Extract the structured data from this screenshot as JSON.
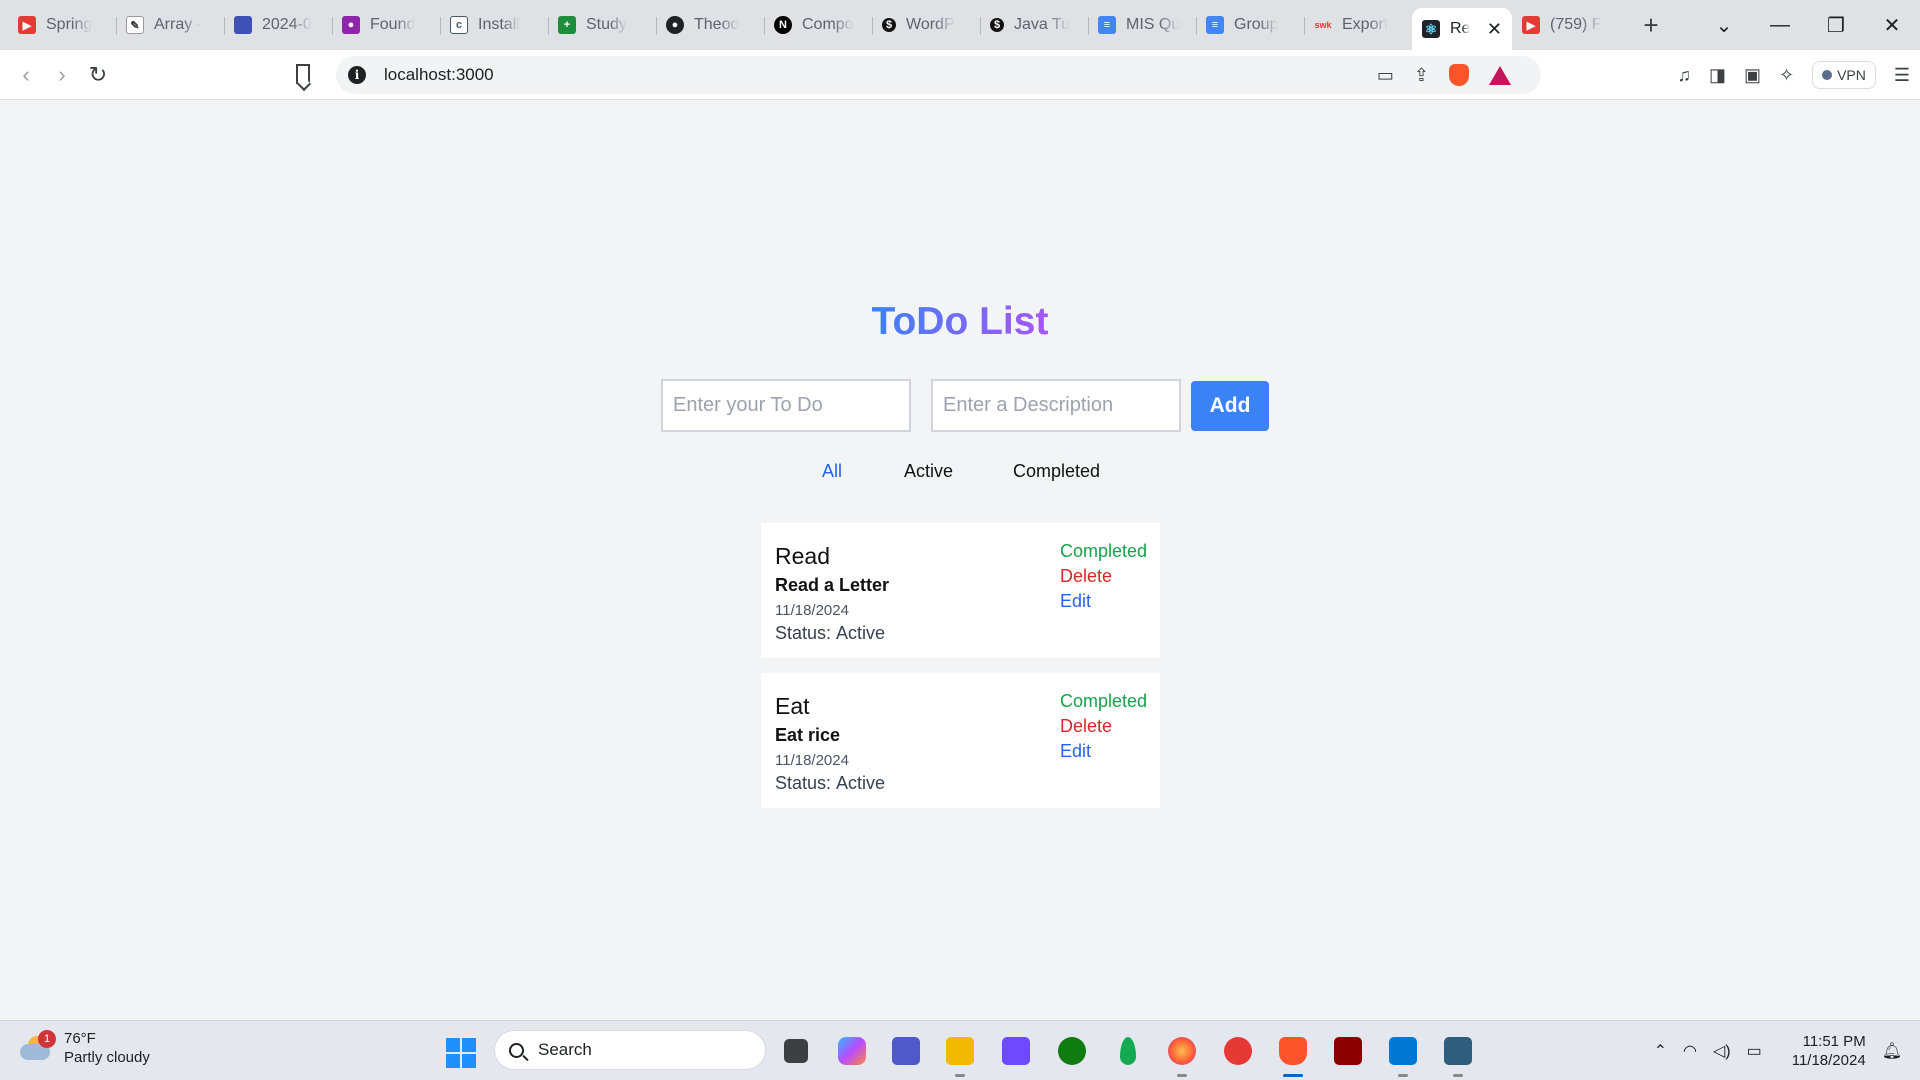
{
  "browser": {
    "tabs": [
      {
        "title": "Spring",
        "color": "#e53935",
        "icon": "youtube-icon"
      },
      {
        "title": "Array -",
        "color": "#333333",
        "icon": "pen-icon"
      },
      {
        "title": "2024-0",
        "color": "#3f51b5",
        "icon": "app-icon"
      },
      {
        "title": "Found",
        "color": "#8e24aa",
        "icon": "people-icon"
      },
      {
        "title": "Install",
        "color": "#455a64",
        "icon": "doc-icon"
      },
      {
        "title": "Study",
        "color": "#1e8e3e",
        "icon": "sheets-icon"
      },
      {
        "title": "Theod",
        "color": "#202124",
        "icon": "github-icon"
      },
      {
        "title": "Compo",
        "color": "#000000",
        "icon": "nextjs-icon"
      },
      {
        "title": "WordP",
        "color": "#111111",
        "icon": "wordpress-icon"
      },
      {
        "title": "Java Tu",
        "color": "#111111",
        "icon": "java-icon"
      },
      {
        "title": "MIS Qu",
        "color": "#4285f4",
        "icon": "docs-icon"
      },
      {
        "title": "Group",
        "color": "#4285f4",
        "icon": "docs-icon"
      },
      {
        "title": "Export",
        "color": "#e53935",
        "icon": "export-icon"
      }
    ],
    "active_tab": {
      "title": "Re",
      "color": "#20232a",
      "icon": "react-icon"
    },
    "last_tab": {
      "title": "(759) F",
      "color": "#e53935",
      "icon": "youtube-icon"
    },
    "url": "localhost:3000",
    "vpn_label": "VPN"
  },
  "app": {
    "title": "ToDo List",
    "todo_placeholder": "Enter your To Do",
    "desc_placeholder": "Enter a Description",
    "add_label": "Add",
    "filters": {
      "all": "All",
      "active": "Active",
      "completed": "Completed"
    },
    "active_filter": "All",
    "status_label": "Status:",
    "actions": {
      "complete": "Completed",
      "delete": "Delete",
      "edit": "Edit"
    },
    "todos": [
      {
        "title": "Read",
        "description": "Read a Letter",
        "date": "11/18/2024",
        "status": "Active"
      },
      {
        "title": "Eat",
        "description": "Eat rice",
        "date": "11/18/2024",
        "status": "Active"
      }
    ]
  },
  "taskbar": {
    "weather_temp": "76°F",
    "weather_desc": "Partly cloudy",
    "weather_badge": "1",
    "search_label": "Search",
    "time": "11:51 PM",
    "date": "11/18/2024",
    "apps": [
      "task-view-icon",
      "copilot-icon",
      "teams-icon",
      "file-explorer-icon",
      "proton-icon",
      "xbox-icon",
      "mongodb-icon",
      "firefox-icon",
      "tomato-icon",
      "brave-icon",
      "maven-icon",
      "vscode-icon",
      "mysql-icon"
    ]
  }
}
